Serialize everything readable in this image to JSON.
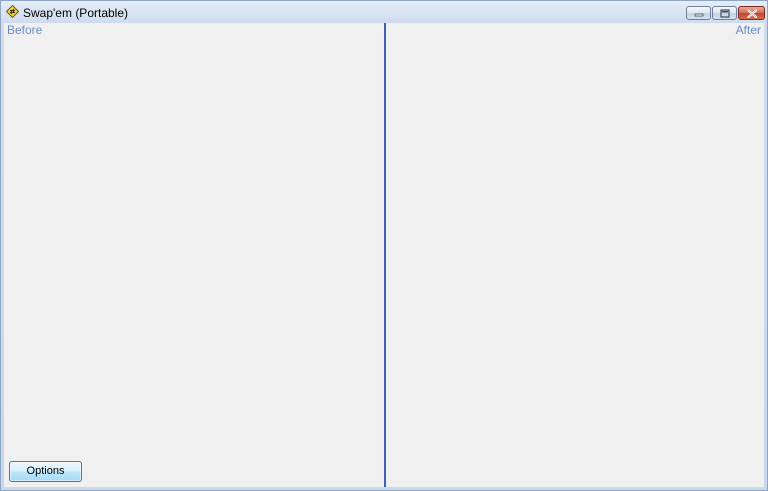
{
  "window": {
    "title": "Swap'em (Portable)",
    "app_icon": "diamond-swap-icon",
    "controls": {
      "minimize_icon": "minimize-icon",
      "maximize_icon": "maximize-icon",
      "close_icon": "close-icon"
    }
  },
  "panes": {
    "before_label": "Before",
    "after_label": "After"
  },
  "buttons": {
    "options_label": "Options"
  },
  "colors": {
    "label_color": "#6a8cc8",
    "divider_color": "#3c63b0",
    "client_background": "#f0f0f0"
  }
}
